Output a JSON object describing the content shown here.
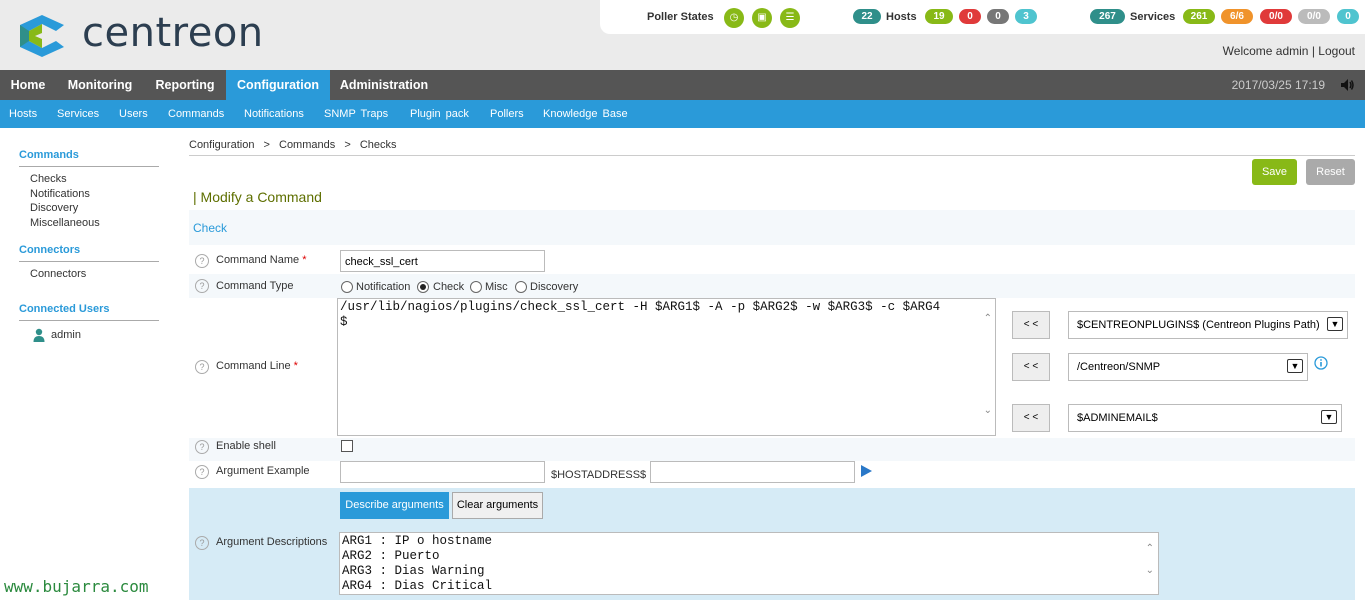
{
  "brand": {
    "logo_text": "centreon"
  },
  "status": {
    "poller_label": "Poller States",
    "hosts_total": "22",
    "hosts_label": "Hosts",
    "hosts_counts": [
      "19",
      "0",
      "0",
      "3"
    ],
    "services_total": "267",
    "services_label": "Services",
    "services_counts": [
      "261",
      "6/6",
      "0/0",
      "0/0",
      "0"
    ]
  },
  "user": {
    "welcome": "Welcome admin",
    "separator": "|",
    "logout": "Logout"
  },
  "nav": {
    "items": [
      "Home",
      "Monitoring",
      "Reporting",
      "Configuration",
      "Administration"
    ],
    "datetime": "2017/03/25 17:19"
  },
  "subnav": {
    "items": [
      "Hosts",
      "Services",
      "Users",
      "Commands",
      "Notifications",
      "SNMP Traps",
      "Plugin pack",
      "Pollers",
      "Knowledge Base"
    ]
  },
  "sidebar": {
    "commands_title": "Commands",
    "commands_items": [
      "Checks",
      "Notifications",
      "Discovery",
      "Miscellaneous"
    ],
    "connectors_title": "Connectors",
    "connectors_items": [
      "Connectors"
    ],
    "users_title": "Connected Users",
    "users_items": [
      "admin"
    ]
  },
  "breadcrumb": {
    "items": [
      "Configuration",
      "Commands",
      "Checks"
    ],
    "separator": ">"
  },
  "toolbar": {
    "save_label": "Save",
    "reset_label": "Reset"
  },
  "page": {
    "title": "| Modify a Command",
    "section": "Check"
  },
  "form": {
    "help_glyph": "?",
    "required_mark": "*",
    "command_name_label": "Command Name",
    "command_name_value": "check_ssl_cert",
    "command_type_label": "Command Type",
    "command_types": [
      "Notification",
      "Check",
      "Misc",
      "Discovery"
    ],
    "command_type_selected": "Check",
    "command_line_label": "Command Line",
    "command_line_value": "/usr/lib/nagios/plugins/check_ssl_cert -H $ARG1$ -A -p $ARG2$ -w $ARG3$ -c $ARG4\n$",
    "macro_button_label": "< <",
    "macro_select_1": "$CENTREONPLUGINS$ (Centreon Plugins Path)",
    "macro_select_2": "/Centreon/SNMP",
    "macro_select_3": "$ADMINEMAIL$",
    "enable_shell_label": "Enable shell",
    "argument_example_label": "Argument Example",
    "hostaddress_label": "$HOSTADDRESS$",
    "describe_args_label": "Describe arguments",
    "clear_args_label": "Clear arguments",
    "argument_descriptions_label": "Argument Descriptions",
    "argument_descriptions_value": "ARG1 : IP o hostname\nARG2 : Puerto\nARG3 : Dias Warning\nARG4 : Dias Critical"
  },
  "watermark": "www.bujarra.com",
  "colors": {
    "accent": "#2a9ad9",
    "nav_bg": "#555555",
    "save": "#88b917",
    "reset": "#aaaaaa",
    "green_pill": "#88b917",
    "red_pill": "#e03a3a",
    "orange_pill": "#f0932b",
    "teal_pill": "#2f8f8a",
    "cyan_pill": "#4fc4cf"
  }
}
